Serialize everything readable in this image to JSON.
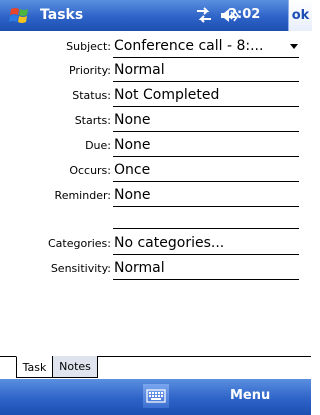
{
  "titlebar": {
    "app_title": "Tasks",
    "clock": "2:02",
    "ok_label": "ok"
  },
  "form": {
    "subject": {
      "label": "Subject:",
      "value": "Conference call - 8:..."
    },
    "priority": {
      "label": "Priority:",
      "value": "Normal"
    },
    "status": {
      "label": "Status:",
      "value": "Not Completed"
    },
    "starts": {
      "label": "Starts:",
      "value": "None"
    },
    "due": {
      "label": "Due:",
      "value": "None"
    },
    "occurs": {
      "label": "Occurs:",
      "value": "Once"
    },
    "reminder": {
      "label": "Reminder:",
      "value": "None"
    },
    "categories": {
      "label": "Categories:",
      "value": "No categories..."
    },
    "sensitivity": {
      "label": "Sensitivity:",
      "value": "Normal"
    }
  },
  "tabs": [
    {
      "label": "Task"
    },
    {
      "label": "Notes"
    }
  ],
  "menubar": {
    "menu_label": "Menu"
  },
  "colors": {
    "bar_blue": "#2e63c8",
    "ok_text": "#1f4fb5"
  },
  "icons": {
    "start": "windows-flag-icon",
    "connectivity": "connectivity-arrows-icon",
    "volume": "volume-icon",
    "sip": "keyboard-icon",
    "dropdown": "chevron-down-icon"
  }
}
